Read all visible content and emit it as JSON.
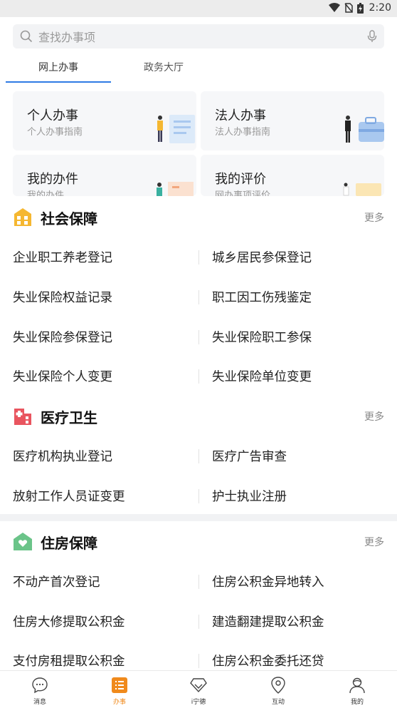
{
  "status_bar": {
    "time": "2:20"
  },
  "search": {
    "placeholder": "查找办事项"
  },
  "tabs": [
    {
      "label": "网上办事",
      "active": true
    },
    {
      "label": "政务大厅",
      "active": false
    }
  ],
  "cards": [
    {
      "title": "个人办事",
      "subtitle": "个人办事指南"
    },
    {
      "title": "法人办事",
      "subtitle": "法人办事指南"
    },
    {
      "title": "我的办件",
      "subtitle": "我的办件"
    },
    {
      "title": "我的评价",
      "subtitle": "网办事项评价"
    }
  ],
  "sections": {
    "social": {
      "title": "社会保障",
      "more": "更多",
      "items": [
        [
          "企业职工养老登记",
          "城乡居民参保登记"
        ],
        [
          "失业保险权益记录",
          "职工因工伤残鉴定"
        ],
        [
          "失业保险参保登记",
          "失业保险职工参保"
        ],
        [
          "失业保险个人变更",
          "失业保险单位变更"
        ]
      ]
    },
    "medical": {
      "title": "医疗卫生",
      "more": "更多",
      "items": [
        [
          "医疗机构执业登记",
          "医疗广告审查"
        ],
        [
          "放射工作人员证变更",
          "护士执业注册"
        ]
      ]
    },
    "housing": {
      "title": "住房保障",
      "more": "更多",
      "items": [
        [
          "不动产首次登记",
          "住房公积金异地转入"
        ],
        [
          "住房大修提取公积金",
          "建造翻建提取公积金"
        ],
        [
          "支付房租提取公积金",
          "住房公积金委托还贷"
        ]
      ]
    }
  },
  "tabbar": [
    {
      "label": "消息",
      "icon": "message-icon",
      "active": false
    },
    {
      "label": "办事",
      "icon": "list-icon",
      "active": true
    },
    {
      "label": "i宁德",
      "icon": "diamond-icon",
      "active": false
    },
    {
      "label": "互动",
      "icon": "location-icon",
      "active": false
    },
    {
      "label": "我的",
      "icon": "user-icon",
      "active": false
    }
  ],
  "colors": {
    "accent_blue": "#2f7be5",
    "active_orange": "#f08a1c",
    "social_icon": "#f5b731",
    "medical_icon": "#e9555f",
    "housing_icon": "#6bc489"
  }
}
